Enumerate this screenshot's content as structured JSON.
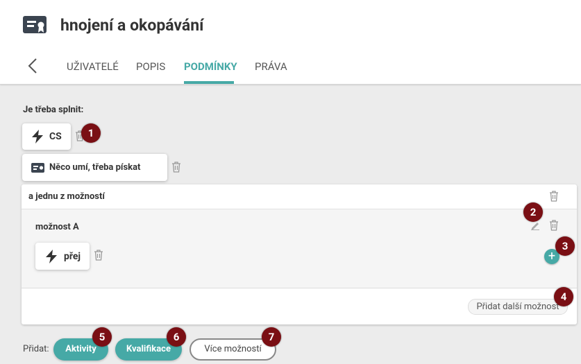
{
  "header": {
    "title": "hnojení a okopávání",
    "tabs": [
      {
        "label": "UŽIVATELÉ"
      },
      {
        "label": "POPIS"
      },
      {
        "label": "PODMÍNKY"
      },
      {
        "label": "PRÁVA"
      }
    ],
    "active_tab": "PODMÍNKY"
  },
  "conditions": {
    "required_label": "Je třeba splnit:",
    "items": [
      {
        "label": "CS",
        "icon": "lightning-icon"
      },
      {
        "label": "Něco umí, třeba pískat",
        "icon": "certificate-icon"
      }
    ],
    "choice_group": {
      "title": "a jednu z možností",
      "option": {
        "title": "možnost A",
        "items": [
          {
            "label": "přej",
            "icon": "lightning-icon"
          }
        ]
      },
      "add_option_label": "Přidat další možnost"
    }
  },
  "footer": {
    "add_label": "Přidat:",
    "buttons": [
      {
        "label": "Aktivity"
      },
      {
        "label": "Kvalifikace"
      },
      {
        "label": "Více možností"
      }
    ]
  },
  "badges": [
    "1",
    "2",
    "3",
    "4",
    "5",
    "6",
    "7"
  ],
  "colors": {
    "accent": "#46a9a6",
    "badge": "#7a0f14",
    "background": "#ececec"
  }
}
